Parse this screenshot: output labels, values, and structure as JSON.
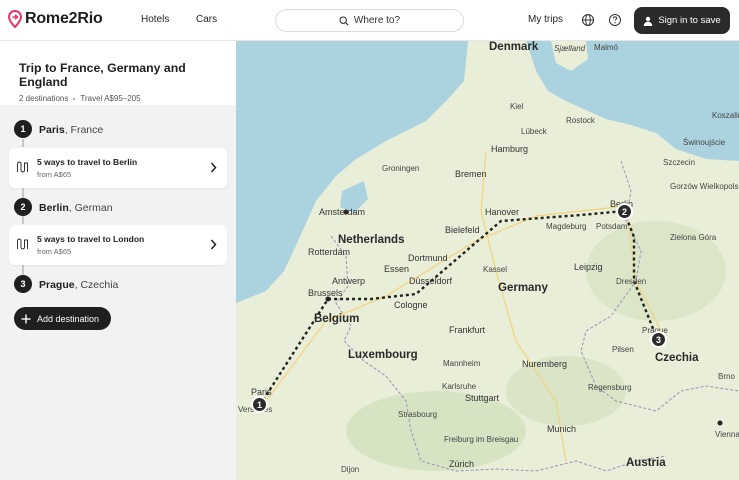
{
  "header": {
    "logo_text": "Rome2Rio",
    "nav": [
      "Hotels",
      "Cars"
    ],
    "search_label": "Where to?",
    "my_trips": "My trips",
    "sign_in": "Sign in to save"
  },
  "trip": {
    "title": "Trip to France, Germany and England",
    "destinations": "2 destinations",
    "travel": "Travel A$95–205"
  },
  "stops": [
    {
      "number": "1",
      "city": "Paris",
      "country": "France"
    },
    {
      "number": "2",
      "city": "Berlin",
      "country": "German"
    },
    {
      "number": "3",
      "city": "Prague",
      "country": "Czechia"
    }
  ],
  "legs": [
    {
      "title": "5 ways to travel to Berlin",
      "price": "from A$65"
    },
    {
      "title": "5 ways to travel to London",
      "price": "from A$65"
    }
  ],
  "add_destination": "Add destination",
  "map": {
    "countries": [
      "Denmark",
      "Netherlands",
      "Belgium",
      "Luxembourg",
      "Germany",
      "Czechia",
      "Austria"
    ],
    "cities": [
      "Malmö",
      "Kiel",
      "Rostock",
      "Lübeck",
      "Hamburg",
      "Bremen",
      "Groningen",
      "Amsterdam",
      "Hanover",
      "Berlin",
      "Szczecin",
      "Bielefeld",
      "Magdeburg",
      "Potsdam",
      "Rotterdam",
      "Dortmund",
      "Essen",
      "Düsseldorf",
      "Kassel",
      "Leipzig",
      "Antwerp",
      "Brussels",
      "Cologne",
      "Dresden",
      "Frankfurt",
      "Prague",
      "Mannheim",
      "Nuremberg",
      "Karlsruhe",
      "Stuttgart",
      "Strasbourg",
      "Munich",
      "Freiburg im Breisgau",
      "Zürich",
      "Paris",
      "Versailles",
      "Dijon",
      "Vienna",
      "Brno",
      "Pilsen",
      "Regensburg",
      "Sjælland",
      "Koszalin",
      "Świnoujście",
      "Gorzów Wielkopolski",
      "Zielona Góra"
    ],
    "markers": [
      "1",
      "2",
      "3"
    ],
    "colors": {
      "water": "#aad3df",
      "land": "#e9eed8",
      "route": "#222222"
    }
  }
}
